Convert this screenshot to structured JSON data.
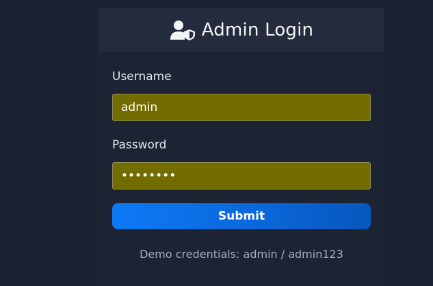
{
  "header": {
    "icon": "user-shield-icon",
    "title": "Admin Login"
  },
  "form": {
    "username": {
      "label": "Username",
      "value": "admin"
    },
    "password": {
      "label": "Password",
      "value": "admin123",
      "masked": true
    },
    "submit_label": "Submit"
  },
  "footer": {
    "demo_credentials": "Demo credentials: admin / admin123"
  },
  "colors": {
    "page_background": "#1b2232",
    "header_background": "#242b3c",
    "input_autofill": "#736c00",
    "button_primary": "#0d7af5"
  }
}
